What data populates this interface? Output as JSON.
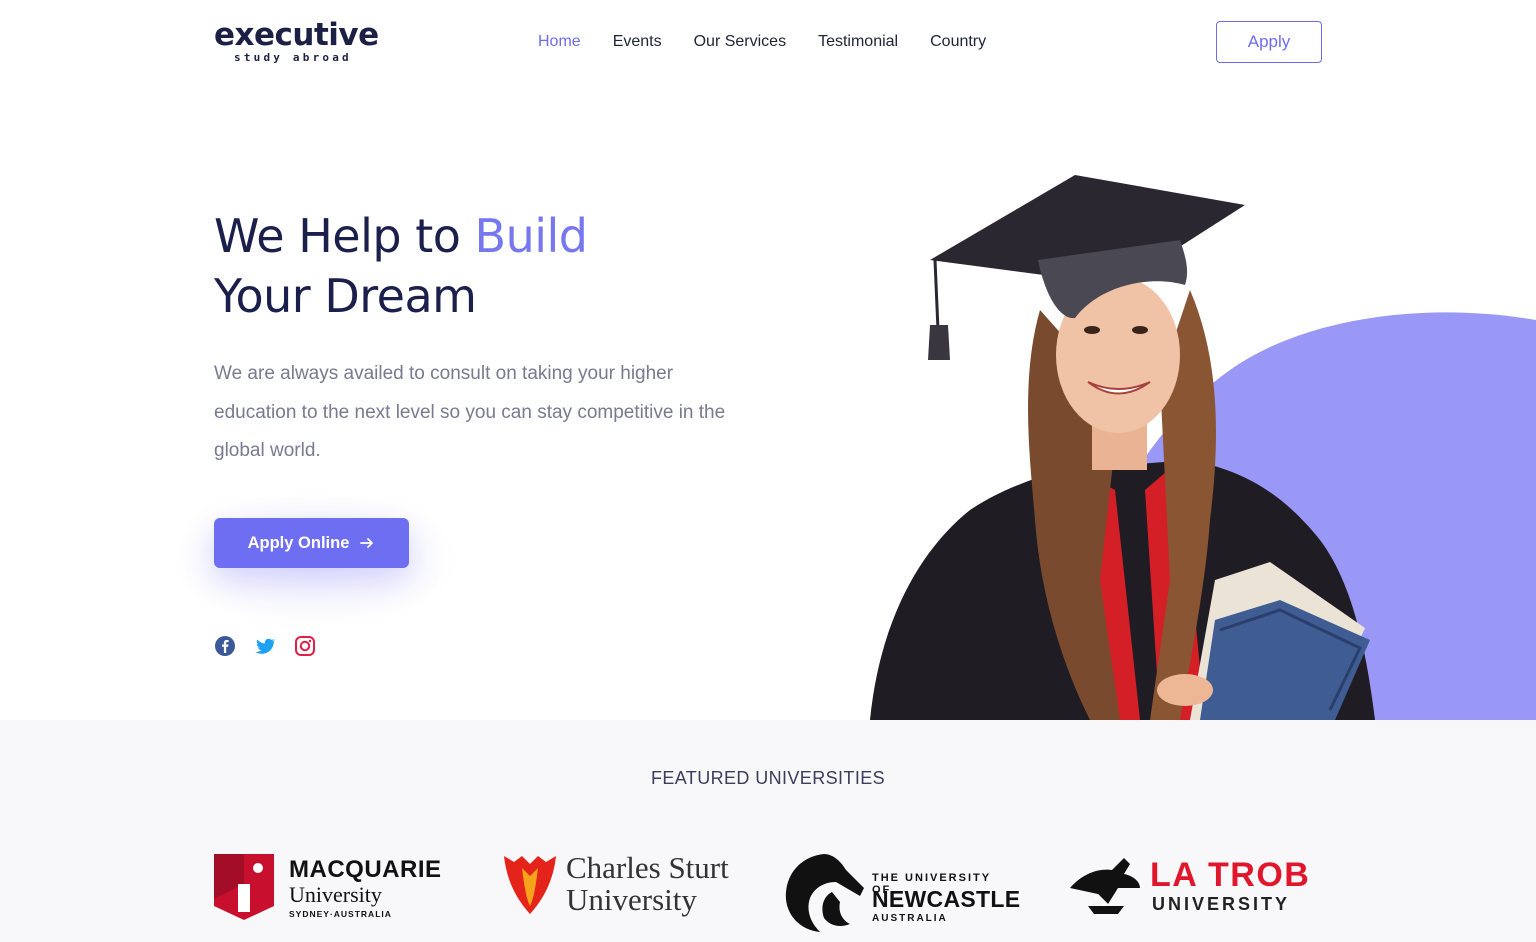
{
  "brand": {
    "name": "executive",
    "tagline": "study abroad"
  },
  "nav": {
    "items": [
      {
        "label": "Home",
        "active": true
      },
      {
        "label": "Events",
        "active": false
      },
      {
        "label": "Our Services",
        "active": false
      },
      {
        "label": "Testimonial",
        "active": false
      },
      {
        "label": "Country",
        "active": false
      }
    ],
    "apply_label": "Apply"
  },
  "hero": {
    "title_part1": "We Help to ",
    "title_accent": "Build",
    "title_line2": "Your Dream",
    "description": "We are always availed to consult on taking your higher education to the next level so you can stay competitive in the global world.",
    "cta_label": "Apply Online",
    "socials": [
      "facebook-icon",
      "twitter-icon",
      "instagram-icon"
    ]
  },
  "featured": {
    "title": "FEATURED UNIVERSITIES",
    "universities": [
      {
        "line1": "MACQUARIE",
        "line2": "University",
        "line3": "SYDNEY·AUSTRALIA"
      },
      {
        "line1": "Charles Sturt",
        "line2": "University"
      },
      {
        "line1": "THE UNIVERSITY OF",
        "line2": "NEWCASTLE",
        "line3": "AUSTRALIA"
      },
      {
        "line1": "LA TROB",
        "line2": "UNIVERSITY"
      }
    ]
  },
  "colors": {
    "accent": "#6e6ef3",
    "accent_light": "#9a9af7",
    "heading": "#1a1f4b",
    "body_text": "#787a90",
    "facebook": "#3b5998",
    "twitter": "#1da1f2",
    "instagram": "#e1306c"
  }
}
